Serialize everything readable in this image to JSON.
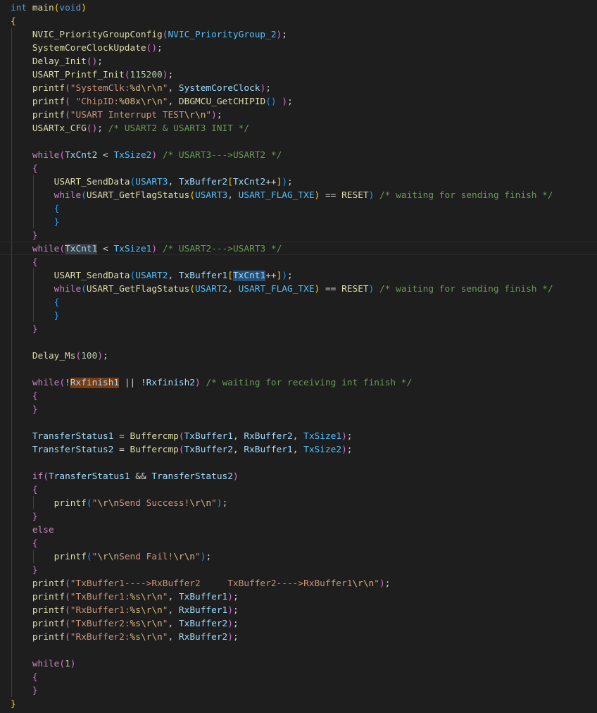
{
  "colors": {
    "background": "#1e1e1e",
    "keyword": "#569cd6",
    "control": "#c586c0",
    "function": "#dcdcaa",
    "variable": "#9cdcfe",
    "macro": "#4fc1ff",
    "string": "#ce9178",
    "escape": "#d7ba7d",
    "number": "#b5cea8",
    "comment": "#6a9955",
    "bracket_1": "#ffd700",
    "bracket_2": "#da70d6",
    "bracket_3": "#179fff"
  },
  "code_lines": [
    [
      [
        "kw",
        "int"
      ],
      [
        "op",
        " "
      ],
      [
        "fn",
        "main"
      ],
      [
        "b1",
        "("
      ],
      [
        "kw",
        "void"
      ],
      [
        "b1",
        ")"
      ]
    ],
    [
      [
        "b1",
        "{"
      ]
    ],
    [
      [
        "op",
        "    "
      ],
      [
        "fn",
        "NVIC_PriorityGroupConfig"
      ],
      [
        "b2",
        "("
      ],
      [
        "mac",
        "NVIC_PriorityGroup_2"
      ],
      [
        "b2",
        ")"
      ],
      [
        "op",
        ";"
      ]
    ],
    [
      [
        "op",
        "    "
      ],
      [
        "fn",
        "SystemCoreClockUpdate"
      ],
      [
        "b2",
        "()"
      ],
      [
        "op",
        ";"
      ]
    ],
    [
      [
        "op",
        "    "
      ],
      [
        "fn",
        "Delay_Init"
      ],
      [
        "b2",
        "()"
      ],
      [
        "op",
        ";"
      ]
    ],
    [
      [
        "op",
        "    "
      ],
      [
        "fn",
        "USART_Printf_Init"
      ],
      [
        "b2",
        "("
      ],
      [
        "num",
        "115200"
      ],
      [
        "b2",
        ")"
      ],
      [
        "op",
        ";"
      ]
    ],
    [
      [
        "op",
        "    "
      ],
      [
        "fn",
        "printf"
      ],
      [
        "b2",
        "("
      ],
      [
        "str",
        "\"SystemClk:"
      ],
      [
        "esc",
        "%d\\r\\n"
      ],
      [
        "str",
        "\""
      ],
      [
        "op",
        ", "
      ],
      [
        "var",
        "SystemCoreClock"
      ],
      [
        "b2",
        ")"
      ],
      [
        "op",
        ";"
      ]
    ],
    [
      [
        "op",
        "    "
      ],
      [
        "fn",
        "printf"
      ],
      [
        "b2",
        "("
      ],
      [
        "op",
        " "
      ],
      [
        "str",
        "\"ChipID:"
      ],
      [
        "esc",
        "%08x\\r\\n"
      ],
      [
        "str",
        "\""
      ],
      [
        "op",
        ", "
      ],
      [
        "fn",
        "DBGMCU_GetCHIPID"
      ],
      [
        "b3",
        "()"
      ],
      [
        "op",
        " "
      ],
      [
        "b2",
        ")"
      ],
      [
        "op",
        ";"
      ]
    ],
    [
      [
        "op",
        "    "
      ],
      [
        "fn",
        "printf"
      ],
      [
        "b2",
        "("
      ],
      [
        "str",
        "\"USART Interrupt TEST"
      ],
      [
        "esc",
        "\\r\\n"
      ],
      [
        "str",
        "\""
      ],
      [
        "b2",
        ")"
      ],
      [
        "op",
        ";"
      ]
    ],
    [
      [
        "op",
        "    "
      ],
      [
        "fn",
        "USARTx_CFG"
      ],
      [
        "b2",
        "()"
      ],
      [
        "op",
        "; "
      ],
      [
        "cmt",
        "/* USART2 & USART3 INIT */"
      ]
    ],
    [],
    [
      [
        "op",
        "    "
      ],
      [
        "ctl",
        "while"
      ],
      [
        "b2",
        "("
      ],
      [
        "var",
        "TxCnt2"
      ],
      [
        "op",
        " < "
      ],
      [
        "mac",
        "TxSize2"
      ],
      [
        "b2",
        ")"
      ],
      [
        "op",
        " "
      ],
      [
        "cmt",
        "/* USART3--->USART2 */"
      ]
    ],
    [
      [
        "op",
        "    "
      ],
      [
        "b2",
        "{"
      ]
    ],
    [
      [
        "op",
        "        "
      ],
      [
        "fn",
        "USART_SendData"
      ],
      [
        "b3",
        "("
      ],
      [
        "mac",
        "USART3"
      ],
      [
        "op",
        ", "
      ],
      [
        "var",
        "TxBuffer2"
      ],
      [
        "b1",
        "["
      ],
      [
        "var",
        "TxCnt2"
      ],
      [
        "op",
        "++"
      ],
      [
        "b1",
        "]"
      ],
      [
        "b3",
        ")"
      ],
      [
        "op",
        ";"
      ]
    ],
    [
      [
        "op",
        "        "
      ],
      [
        "ctl",
        "while"
      ],
      [
        "b3",
        "("
      ],
      [
        "fn",
        "USART_GetFlagStatus"
      ],
      [
        "b1",
        "("
      ],
      [
        "mac",
        "USART3"
      ],
      [
        "op",
        ", "
      ],
      [
        "mac",
        "USART_FLAG_TXE"
      ],
      [
        "b1",
        ")"
      ],
      [
        "op",
        " == "
      ],
      [
        "fn",
        "RESET"
      ],
      [
        "b3",
        ")"
      ],
      [
        "op",
        " "
      ],
      [
        "cmt",
        "/* waiting for sending finish */"
      ]
    ],
    [
      [
        "op",
        "        "
      ],
      [
        "b3",
        "{"
      ]
    ],
    [
      [
        "op",
        "        "
      ],
      [
        "b3",
        "}"
      ]
    ],
    [
      [
        "op",
        "    "
      ],
      [
        "b2",
        "}"
      ]
    ],
    [
      [
        "op",
        "    "
      ],
      [
        "ctl",
        "while"
      ],
      [
        "b2",
        "("
      ],
      [
        "var hl",
        "TxCnt1"
      ],
      [
        "op",
        " < "
      ],
      [
        "mac",
        "TxSize1"
      ],
      [
        "b2",
        ")"
      ],
      [
        "op",
        " "
      ],
      [
        "cmt",
        "/* USART2--->USART3 */"
      ]
    ],
    [
      [
        "op",
        "    "
      ],
      [
        "b2",
        "{"
      ]
    ],
    [
      [
        "op",
        "        "
      ],
      [
        "fn",
        "USART_SendData"
      ],
      [
        "b3",
        "("
      ],
      [
        "mac",
        "USART2"
      ],
      [
        "op",
        ", "
      ],
      [
        "var",
        "TxBuffer1"
      ],
      [
        "b1",
        "["
      ],
      [
        "var hl2",
        "TxCnt1"
      ],
      [
        "op",
        "++"
      ],
      [
        "b1",
        "]"
      ],
      [
        "b3",
        ")"
      ],
      [
        "op",
        ";"
      ]
    ],
    [
      [
        "op",
        "        "
      ],
      [
        "ctl",
        "while"
      ],
      [
        "b3",
        "("
      ],
      [
        "fn",
        "USART_GetFlagStatus"
      ],
      [
        "b1",
        "("
      ],
      [
        "mac",
        "USART2"
      ],
      [
        "op",
        ", "
      ],
      [
        "mac",
        "USART_FLAG_TXE"
      ],
      [
        "b1",
        ")"
      ],
      [
        "op",
        " == "
      ],
      [
        "fn",
        "RESET"
      ],
      [
        "b3",
        ")"
      ],
      [
        "op",
        " "
      ],
      [
        "cmt",
        "/* waiting for sending finish */"
      ]
    ],
    [
      [
        "op",
        "        "
      ],
      [
        "b3",
        "{"
      ]
    ],
    [
      [
        "op",
        "        "
      ],
      [
        "b3",
        "}"
      ]
    ],
    [
      [
        "op",
        "    "
      ],
      [
        "b2",
        "}"
      ]
    ],
    [],
    [
      [
        "op",
        "    "
      ],
      [
        "fn",
        "Delay_Ms"
      ],
      [
        "b2",
        "("
      ],
      [
        "num",
        "100"
      ],
      [
        "b2",
        ")"
      ],
      [
        "op",
        ";"
      ]
    ],
    [],
    [
      [
        "op",
        "    "
      ],
      [
        "ctl",
        "while"
      ],
      [
        "b2",
        "("
      ],
      [
        "op",
        "!"
      ],
      [
        "var hl3",
        "Rxfinish1"
      ],
      [
        "op",
        " || !"
      ],
      [
        "var",
        "Rxfinish2"
      ],
      [
        "b2",
        ")"
      ],
      [
        "op",
        " "
      ],
      [
        "cmt",
        "/* waiting for receiving int finish */"
      ]
    ],
    [
      [
        "op",
        "    "
      ],
      [
        "b2",
        "{"
      ]
    ],
    [
      [
        "op",
        "    "
      ],
      [
        "b2",
        "}"
      ]
    ],
    [],
    [
      [
        "op",
        "    "
      ],
      [
        "var",
        "TransferStatus1"
      ],
      [
        "op",
        " = "
      ],
      [
        "fn",
        "Buffercmp"
      ],
      [
        "b2",
        "("
      ],
      [
        "var",
        "TxBuffer1"
      ],
      [
        "op",
        ", "
      ],
      [
        "var",
        "RxBuffer2"
      ],
      [
        "op",
        ", "
      ],
      [
        "mac",
        "TxSize1"
      ],
      [
        "b2",
        ")"
      ],
      [
        "op",
        ";"
      ]
    ],
    [
      [
        "op",
        "    "
      ],
      [
        "var",
        "TransferStatus2"
      ],
      [
        "op",
        " = "
      ],
      [
        "fn",
        "Buffercmp"
      ],
      [
        "b2",
        "("
      ],
      [
        "var",
        "TxBuffer2"
      ],
      [
        "op",
        ", "
      ],
      [
        "var",
        "RxBuffer1"
      ],
      [
        "op",
        ", "
      ],
      [
        "mac",
        "TxSize2"
      ],
      [
        "b2",
        ")"
      ],
      [
        "op",
        ";"
      ]
    ],
    [],
    [
      [
        "op",
        "    "
      ],
      [
        "ctl",
        "if"
      ],
      [
        "b2",
        "("
      ],
      [
        "var",
        "TransferStatus1"
      ],
      [
        "op",
        " && "
      ],
      [
        "var",
        "TransferStatus2"
      ],
      [
        "b2",
        ")"
      ]
    ],
    [
      [
        "op",
        "    "
      ],
      [
        "b2",
        "{"
      ]
    ],
    [
      [
        "op",
        "        "
      ],
      [
        "fn",
        "printf"
      ],
      [
        "b3",
        "("
      ],
      [
        "str",
        "\""
      ],
      [
        "esc",
        "\\r\\n"
      ],
      [
        "str",
        "Send Success!"
      ],
      [
        "esc",
        "\\r\\n"
      ],
      [
        "str",
        "\""
      ],
      [
        "b3",
        ")"
      ],
      [
        "op",
        ";"
      ]
    ],
    [
      [
        "op",
        "    "
      ],
      [
        "b2",
        "}"
      ]
    ],
    [
      [
        "op",
        "    "
      ],
      [
        "ctl",
        "else"
      ]
    ],
    [
      [
        "op",
        "    "
      ],
      [
        "b2",
        "{"
      ]
    ],
    [
      [
        "op",
        "        "
      ],
      [
        "fn",
        "printf"
      ],
      [
        "b3",
        "("
      ],
      [
        "str",
        "\""
      ],
      [
        "esc",
        "\\r\\n"
      ],
      [
        "str",
        "Send Fail!"
      ],
      [
        "esc",
        "\\r\\n"
      ],
      [
        "str",
        "\""
      ],
      [
        "b3",
        ")"
      ],
      [
        "op",
        ";"
      ]
    ],
    [
      [
        "op",
        "    "
      ],
      [
        "b2",
        "}"
      ]
    ],
    [
      [
        "op",
        "    "
      ],
      [
        "fn",
        "printf"
      ],
      [
        "b2",
        "("
      ],
      [
        "str",
        "\"TxBuffer1---->RxBuffer2     TxBuffer2---->RxBuffer1"
      ],
      [
        "esc",
        "\\r\\n"
      ],
      [
        "str",
        "\""
      ],
      [
        "b2",
        ")"
      ],
      [
        "op",
        ";"
      ]
    ],
    [
      [
        "op",
        "    "
      ],
      [
        "fn",
        "printf"
      ],
      [
        "b2",
        "("
      ],
      [
        "str",
        "\"TxBuffer1:"
      ],
      [
        "esc",
        "%s\\r\\n"
      ],
      [
        "str",
        "\""
      ],
      [
        "op",
        ", "
      ],
      [
        "var",
        "TxBuffer1"
      ],
      [
        "b2",
        ")"
      ],
      [
        "op",
        ";"
      ]
    ],
    [
      [
        "op",
        "    "
      ],
      [
        "fn",
        "printf"
      ],
      [
        "b2",
        "("
      ],
      [
        "str",
        "\"RxBuffer1:"
      ],
      [
        "esc",
        "%s\\r\\n"
      ],
      [
        "str",
        "\""
      ],
      [
        "op",
        ", "
      ],
      [
        "var",
        "RxBuffer1"
      ],
      [
        "b2",
        ")"
      ],
      [
        "op",
        ";"
      ]
    ],
    [
      [
        "op",
        "    "
      ],
      [
        "fn",
        "printf"
      ],
      [
        "b2",
        "("
      ],
      [
        "str",
        "\"TxBuffer2:"
      ],
      [
        "esc",
        "%s\\r\\n"
      ],
      [
        "str",
        "\""
      ],
      [
        "op",
        ", "
      ],
      [
        "var",
        "TxBuffer2"
      ],
      [
        "b2",
        ")"
      ],
      [
        "op",
        ";"
      ]
    ],
    [
      [
        "op",
        "    "
      ],
      [
        "fn",
        "printf"
      ],
      [
        "b2",
        "("
      ],
      [
        "str",
        "\"RxBuffer2:"
      ],
      [
        "esc",
        "%s\\r\\n"
      ],
      [
        "str",
        "\""
      ],
      [
        "op",
        ", "
      ],
      [
        "var",
        "RxBuffer2"
      ],
      [
        "b2",
        ")"
      ],
      [
        "op",
        ";"
      ]
    ],
    [],
    [
      [
        "op",
        "    "
      ],
      [
        "ctl",
        "while"
      ],
      [
        "b2",
        "("
      ],
      [
        "num",
        "1"
      ],
      [
        "b2",
        ")"
      ]
    ],
    [
      [
        "op",
        "    "
      ],
      [
        "b2",
        "{"
      ]
    ],
    [
      [
        "op",
        "    "
      ],
      [
        "b2",
        "}"
      ]
    ],
    [
      [
        "b1",
        "}"
      ]
    ]
  ]
}
